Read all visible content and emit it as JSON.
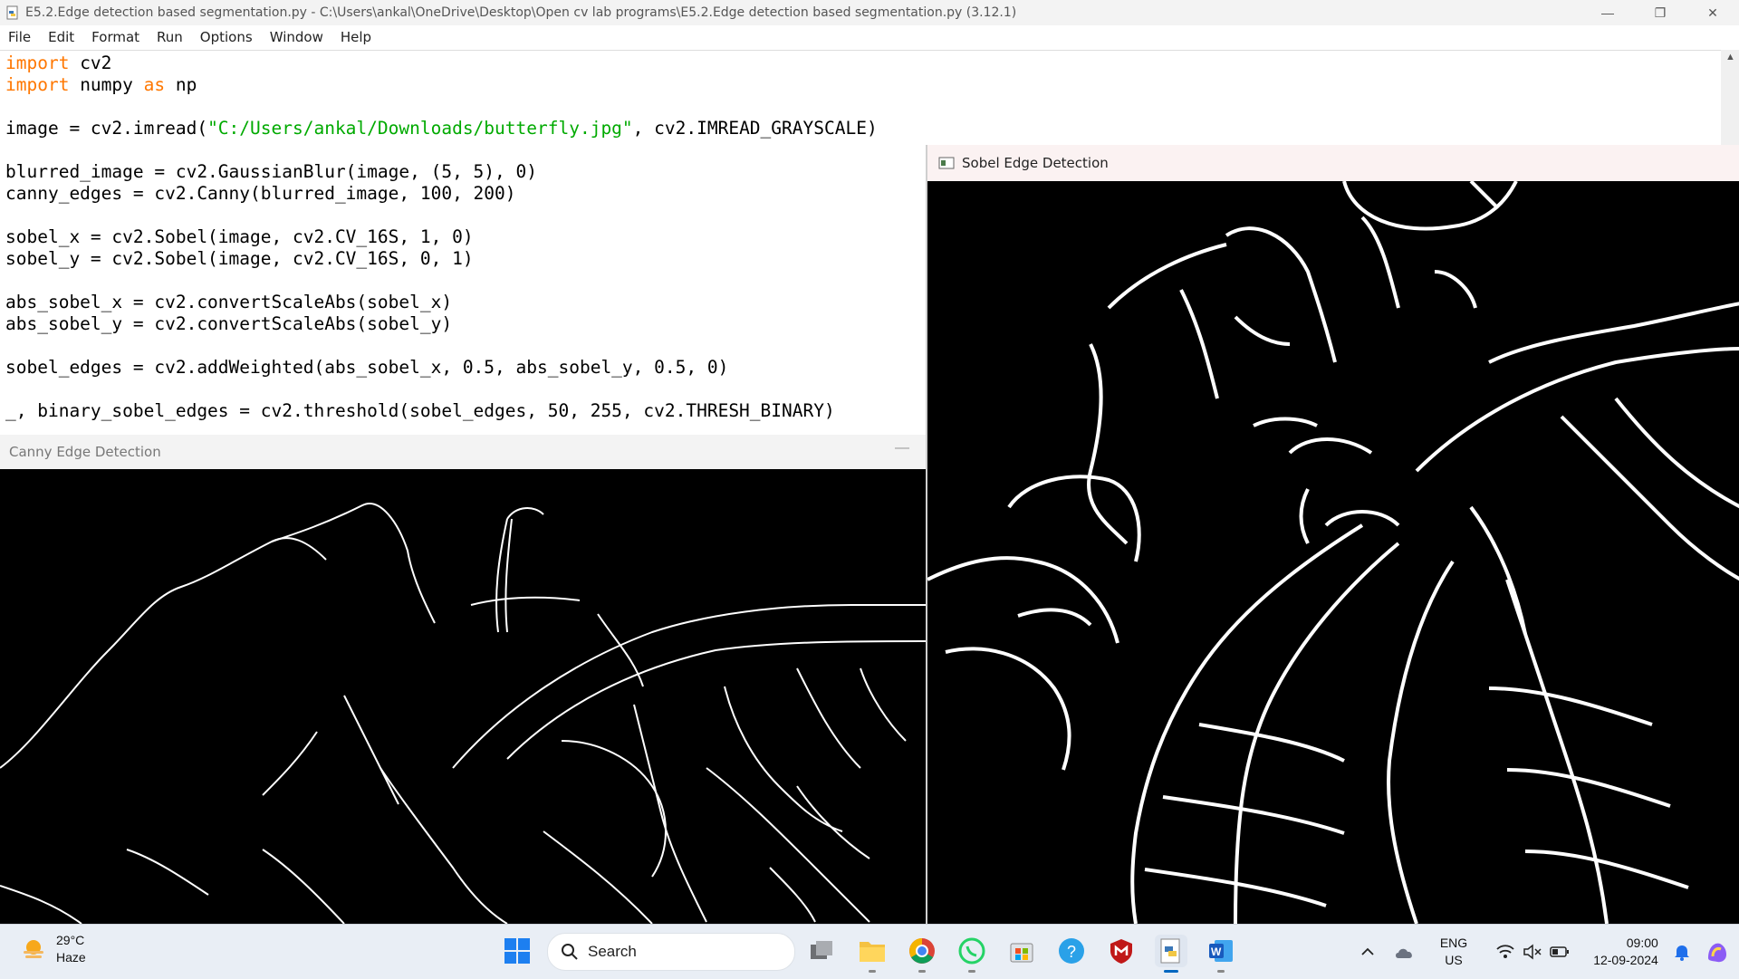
{
  "idle": {
    "title": "E5.2.Edge detection based segmentation.py - C:\\Users\\ankal\\OneDrive\\Desktop\\Open cv lab programs\\E5.2.Edge detection based segmentation.py (3.12.1)",
    "menu": [
      "File",
      "Edit",
      "Format",
      "Run",
      "Options",
      "Window",
      "Help"
    ],
    "code": [
      {
        "kw": "import",
        "rest": " cv2"
      },
      {
        "kw": "import",
        "rest": " numpy ",
        "kw2": "as",
        "rest2": " np"
      },
      {
        "pre": "image = cv2.imread(",
        "str": "\"C:/Users/ankal/Downloads/butterfly.jpg\"",
        "post": ", cv2.IMREAD_GRAYSCALE)"
      },
      {
        "text": "blurred_image = cv2.GaussianBlur(image, (5, 5), 0)"
      },
      {
        "text": "canny_edges = cv2.Canny(blurred_image, 100, 200)"
      },
      {
        "text": "sobel_x = cv2.Sobel(image, cv2.CV_16S, 1, 0)"
      },
      {
        "text": "sobel_y = cv2.Sobel(image, cv2.CV_16S, 0, 1)"
      },
      {
        "text": "abs_sobel_x = cv2.convertScaleAbs(sobel_x)"
      },
      {
        "text": "abs_sobel_y = cv2.convertScaleAbs(sobel_y)"
      },
      {
        "text": "sobel_edges = cv2.addWeighted(abs_sobel_x, 0.5, abs_sobel_y, 0.5, 0)"
      },
      {
        "text": "_, binary_sobel_edges = cv2.threshold(sobel_edges, 50, 255, cv2.THRESH_BINARY)"
      }
    ]
  },
  "canny_window": {
    "title": "Canny Edge Detection"
  },
  "sobel_window": {
    "title": "Sobel Edge Detection"
  },
  "taskbar": {
    "weather": {
      "temp": "29°C",
      "condition": "Haze",
      "icon": "sun-haze-icon"
    },
    "search_label": "Search",
    "apps": [
      "task-view",
      "file-explorer",
      "chrome",
      "whatsapp",
      "microsoft-store",
      "python-help",
      "mcafee",
      "idle-python",
      "word"
    ],
    "lang_top": "ENG",
    "lang_bottom": "US",
    "time": "09:00",
    "date": "12-09-2024"
  },
  "colors": {
    "keyword": "#ff7700",
    "string": "#00aa00",
    "taskbar": "#e9eef5"
  }
}
